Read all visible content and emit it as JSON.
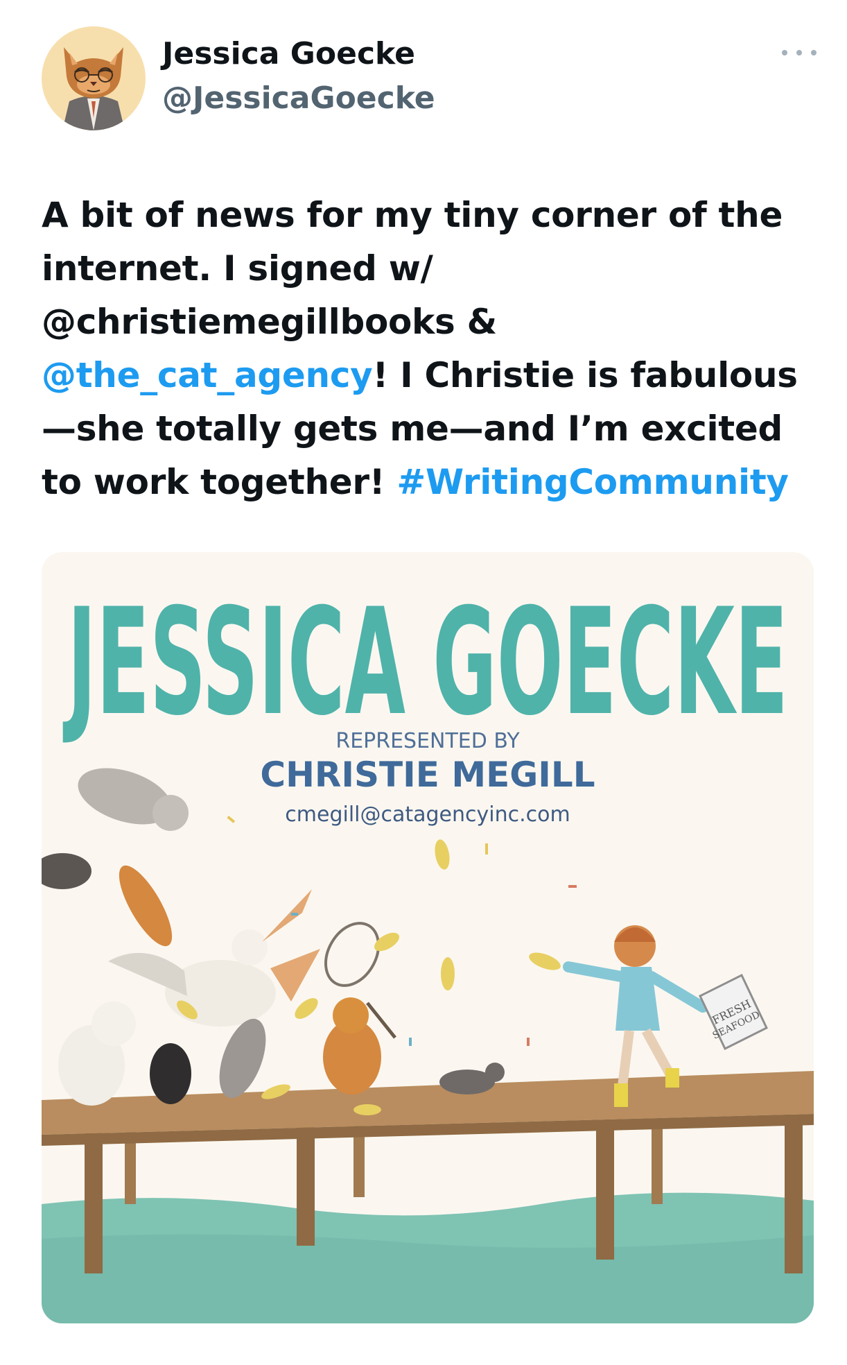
{
  "author": {
    "name": "Jessica Goecke",
    "handle": "@JessicaGoecke",
    "avatar_icon": "cat-avatar-icon"
  },
  "menu": {
    "icon": "more-options-icon"
  },
  "tweet": {
    "line1": "A bit of news for my tiny corner of the",
    "line2": "internet. I signed w/",
    "line3": "@christiemegillbooks &",
    "mention2": "@the_cat_agency",
    "line4_rest": "! I Christie is fabulous",
    "line5": "—she totally gets me—and I’m excited",
    "line6_pre": "to work together! ",
    "hashtag": "#WritingCommunity"
  },
  "image": {
    "title": "JESSICA GOECKE",
    "represented_by": "REPRESENTED BY",
    "agent": "CHRISTIE MEGILL",
    "email": "cmegill@catagencyinc.com",
    "bucket_label_1": "FRESH",
    "bucket_label_2": "SEAFOOD"
  },
  "colors": {
    "link": "#1d9bf0",
    "text": "#0f1419",
    "secondary": "#536471",
    "title_teal": "#3fa9a3",
    "water": "#7fc3b3",
    "dock": "#b98d5f"
  }
}
